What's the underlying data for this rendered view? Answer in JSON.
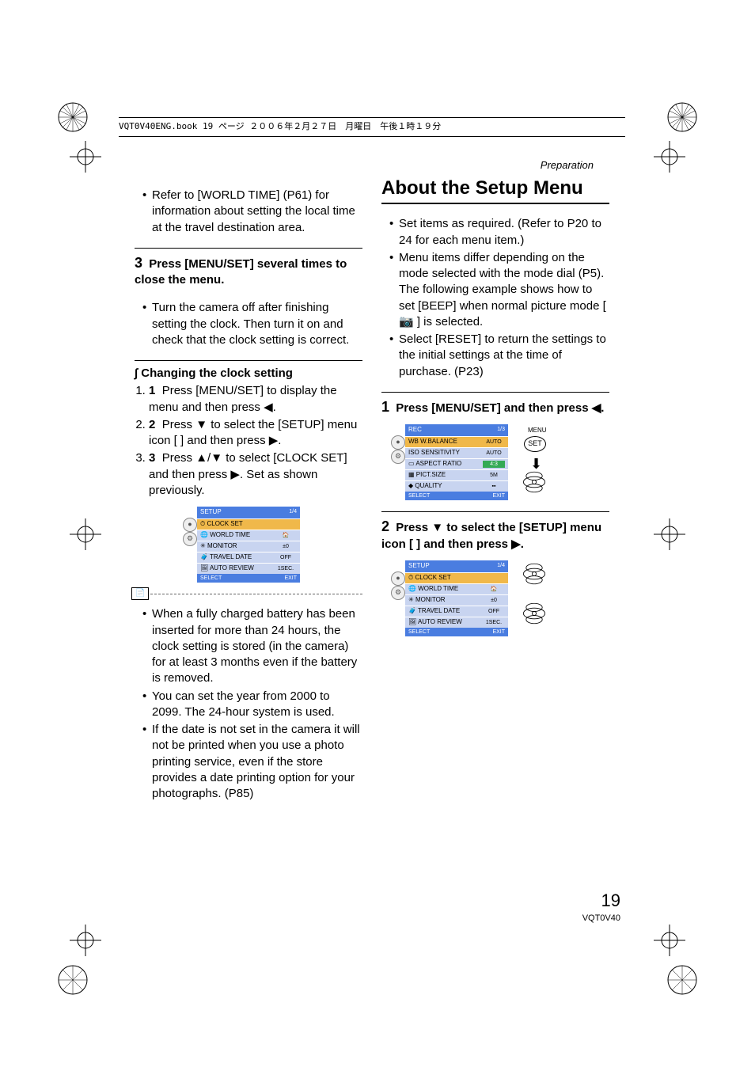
{
  "header": "VQT0V40ENG.book  19 ページ  ２００６年２月２７日　月曜日　午後１時１９分",
  "section": "Preparation",
  "left": {
    "bullet1": "Refer to [WORLD TIME] (P61) for information about setting the local time at the travel destination area.",
    "step3_title": "Press [MENU/SET] several times to close the menu.",
    "step3_sub": "Turn the camera off after finishing setting the clock. Then turn it on and check that the clock setting is correct.",
    "change_h": "Changing the clock setting",
    "c1": "Press [MENU/SET] to display the menu and then press ◀.",
    "c2": "Press ▼ to select the [SETUP] menu icon [ ] and then press ▶.",
    "c3": "Press ▲/▼ to select [CLOCK SET] and then press ▶. Set as shown previously.",
    "n1": "When a fully charged battery has been inserted for more than 24 hours, the clock setting is stored (in the camera) for at least 3 months even if the battery is removed.",
    "n2": "You can set the year from 2000 to 2099. The 24-hour system is used.",
    "n3": "If the date is not set in the camera it will not be printed when you use a photo printing service, even if the store provides a date printing option for your photographs. (P85)"
  },
  "right": {
    "title": "About the Setup Menu",
    "b1": "Set items as required. (Refer to P20 to 24 for each menu item.)",
    "b2a": "Menu items differ depending on the mode selected with the mode dial (P5).",
    "b2b": "The following example shows how to set [BEEP] when normal picture mode [ 📷 ] is selected.",
    "b3": "Select [RESET] to return the settings to the initial settings at the time of purchase. (P23)",
    "s1": "Press [MENU/SET] and then press ◀.",
    "s2": "Press ▼ to select the [SETUP] menu icon [ ] and then press ▶."
  },
  "lcd_setup": {
    "title": "SETUP",
    "page": "1/4",
    "rows": [
      {
        "label": "CLOCK SET",
        "val": ""
      },
      {
        "label": "WORLD TIME",
        "val": "🏠"
      },
      {
        "label": "MONITOR",
        "val": "±0"
      },
      {
        "label": "TRAVEL DATE",
        "val": "OFF"
      },
      {
        "label": "AUTO REVIEW",
        "val": "1SEC."
      }
    ],
    "select": "SELECT",
    "exit": "EXIT"
  },
  "lcd_rec": {
    "title": "REC",
    "page": "1/3",
    "rows": [
      {
        "label": "W.BALANCE",
        "val": "AUTO"
      },
      {
        "label": "SENSITIVITY",
        "val": "AUTO"
      },
      {
        "label": "ASPECT RATIO",
        "val": "4:3"
      },
      {
        "label": "PICT.SIZE",
        "val": "5M"
      },
      {
        "label": "QUALITY",
        "val": "▪▪"
      }
    ],
    "select": "SELECT",
    "exit": "EXIT",
    "menu": "MENU",
    "set": "SET"
  },
  "footer": {
    "page": "19",
    "code": "VQT0V40"
  }
}
